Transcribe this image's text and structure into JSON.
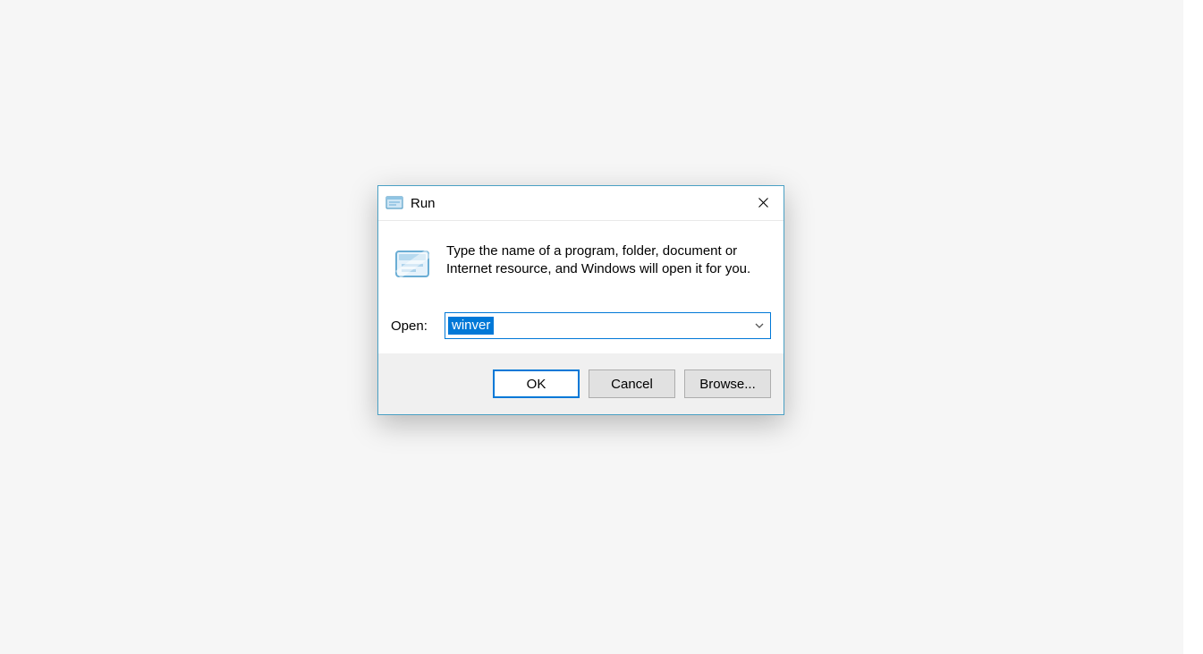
{
  "dialog": {
    "title": "Run",
    "description": "Type the name of a program, folder, document or Internet resource, and Windows will open it for you.",
    "open_label": "Open:",
    "open_value": "winver",
    "buttons": {
      "ok": "OK",
      "cancel": "Cancel",
      "browse": "Browse..."
    }
  }
}
